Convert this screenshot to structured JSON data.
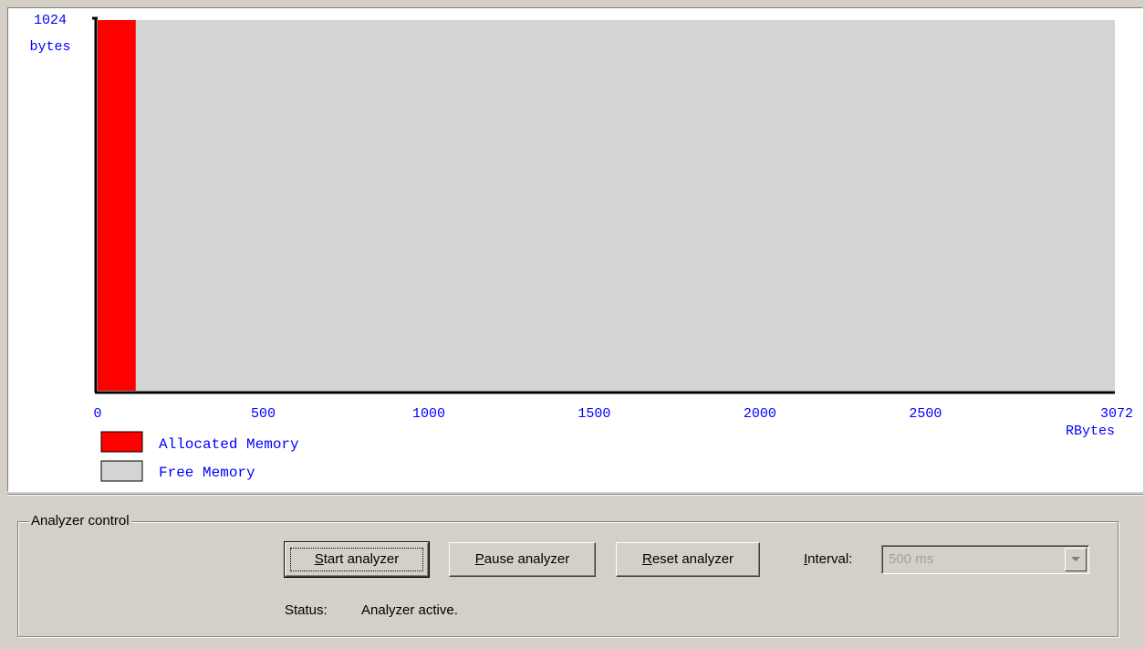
{
  "chart_data": {
    "type": "bar",
    "y_label_top": "1024",
    "y_label_unit": "bytes",
    "x_ticks": [
      "0",
      "500",
      "1000",
      "1500",
      "2000",
      "2500",
      "3072"
    ],
    "x_tick_values": [
      0,
      500,
      1000,
      1500,
      2000,
      2500,
      3072
    ],
    "x_unit": "RBytes",
    "xlim": [
      0,
      3072
    ],
    "allocated_kb": 115,
    "total_kb": 3072,
    "legend": [
      {
        "label": "Allocated Memory",
        "color": "#ff0000"
      },
      {
        "label": "Free Memory",
        "color": "#d4d4d4"
      }
    ],
    "colors": {
      "allocated": "#ff0000",
      "free": "#d4d4d4",
      "axis": "#000000",
      "text": "#0000ff"
    }
  },
  "control": {
    "group_title": "Analyzer control",
    "start_label_u": "S",
    "start_label_rest": "tart analyzer",
    "pause_label_u": "P",
    "pause_label_rest": "ause analyzer",
    "reset_label_u": "R",
    "reset_label_rest": "eset analyzer",
    "interval_label_u": "I",
    "interval_label_rest": "nterval:",
    "interval_value": "500 ms",
    "status_label": "Status:",
    "status_value": "Analyzer active."
  }
}
